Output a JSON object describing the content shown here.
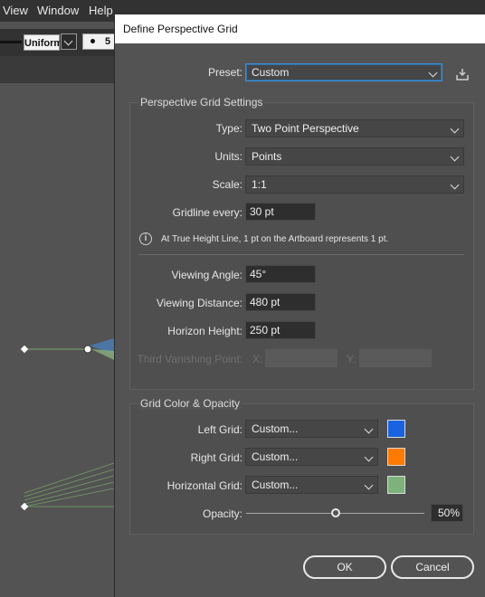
{
  "menubar": {
    "items": [
      "View",
      "Window",
      "Help"
    ]
  },
  "control_bar": {
    "stroke_profile": "Uniform",
    "brush_size": "5"
  },
  "dialog": {
    "title": "Define Perspective Grid",
    "preset": {
      "label": "Preset:",
      "value": "Custom"
    },
    "grid_settings": {
      "title": "Perspective Grid Settings",
      "type": {
        "label": "Type:",
        "value": "Two Point Perspective"
      },
      "units": {
        "label": "Units:",
        "value": "Points"
      },
      "scale": {
        "label": "Scale:",
        "value": "1:1"
      },
      "gridline_every": {
        "label": "Gridline every:",
        "value": "30 pt"
      },
      "info": "At True Height Line, 1 pt on the Artboard represents 1 pt.",
      "viewing_angle": {
        "label": "Viewing Angle:",
        "value": "45°"
      },
      "viewing_distance": {
        "label": "Viewing Distance:",
        "value": "480 pt"
      },
      "horizon_height": {
        "label": "Horizon Height:",
        "value": "250 pt"
      },
      "third_vp": {
        "label": "Third Vanishing Point:",
        "x_label": "X:",
        "y_label": "Y:",
        "x_value": "",
        "y_value": ""
      }
    },
    "color_opacity": {
      "title": "Grid Color & Opacity",
      "left_grid": {
        "label": "Left Grid:",
        "value": "Custom...",
        "color": "#1a63e0"
      },
      "right_grid": {
        "label": "Right Grid:",
        "value": "Custom...",
        "color": "#ff7a00"
      },
      "horizontal_grid": {
        "label": "Horizontal Grid:",
        "value": "Custom...",
        "color": "#7db37b"
      },
      "opacity": {
        "label": "Opacity:",
        "value": "50%",
        "fraction": 0.5
      }
    },
    "buttons": {
      "ok": "OK",
      "cancel": "Cancel"
    }
  }
}
